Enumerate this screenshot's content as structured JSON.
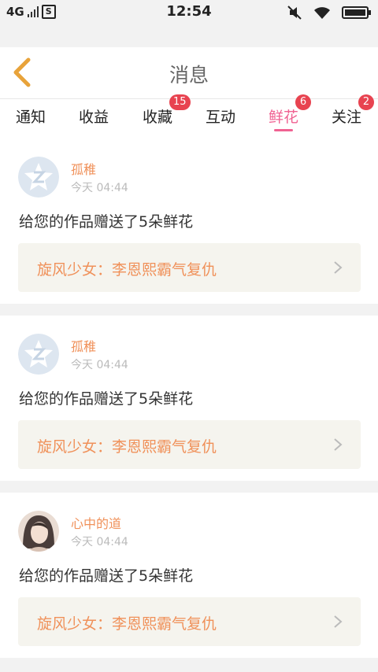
{
  "status_bar": {
    "network": "4G",
    "time": "12:54",
    "battery_level": 1.0
  },
  "header": {
    "title": "消息"
  },
  "tabs": [
    {
      "label": "通知",
      "badge": ""
    },
    {
      "label": "收益",
      "badge": ""
    },
    {
      "label": "收藏",
      "badge": "15"
    },
    {
      "label": "互动",
      "badge": ""
    },
    {
      "label": "鲜花",
      "badge": "6",
      "active": true
    },
    {
      "label": "关注",
      "badge": "2"
    }
  ],
  "messages": [
    {
      "user": "孤稚",
      "time": "今天 04:44",
      "text": "给您的作品赠送了5朵鲜花",
      "work_title": "旋风少女：李恩熙霸气复仇",
      "avatar": "default-avatar-icon"
    },
    {
      "user": "孤稚",
      "time": "今天 04:44",
      "text": "给您的作品赠送了5朵鲜花",
      "work_title": "旋风少女：李恩熙霸气复仇",
      "avatar": "default-avatar-icon"
    },
    {
      "user": "心中的道",
      "time": "今天 04:44",
      "text": "给您的作品赠送了5朵鲜花",
      "work_title": "旋风少女：李恩熙霸气复仇",
      "avatar": "user-photo"
    }
  ],
  "colors": {
    "accent": "#f06292",
    "badge": "#e84350",
    "name": "#f0915a",
    "back_arrow": "#e8a33a"
  }
}
